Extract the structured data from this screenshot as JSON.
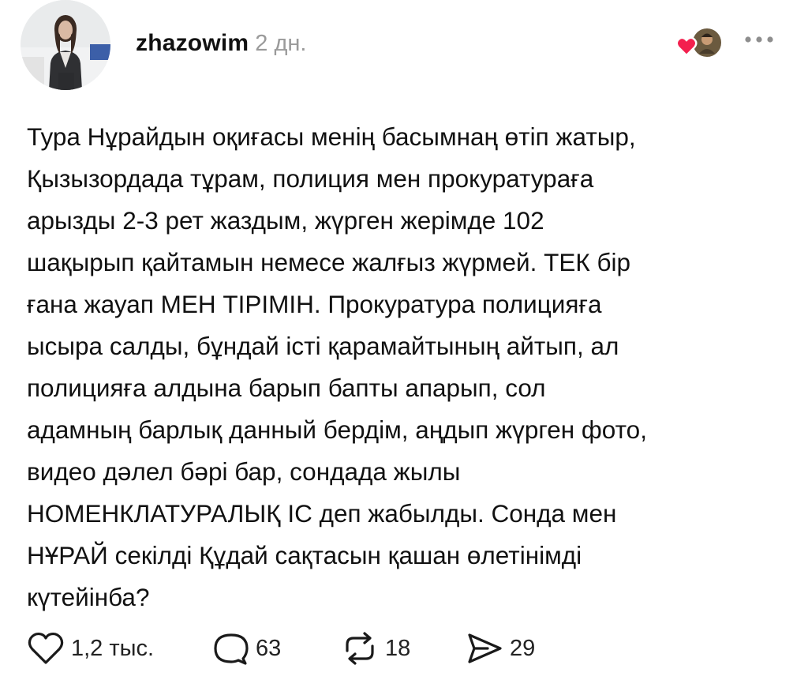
{
  "post": {
    "author": {
      "username": "zhazowim",
      "time": "2 дн."
    },
    "text": "Тура Нұрайдын оқиғасы менің басымнаң өтіп жатыр,\nҚызызордада тұрам, полиция мен прокуратураға\nарызды 2-3 рет жаздым, жүрген жерімде 102\nшақырып қайтамын немесе жалғыз жүрмей. ТЕК бір\nғана жауап МЕН ТІРІМІН. Прокуратура полицияға\nысыра салды, бұндай істі қарамайтының айтып, ал\nполицияға алдына барып бапты апарып, сол\nадамның барлық данный бердім, аңдып жүрген фото,\nвидео дәлел бәрі бар, сондада жылы\nНОМЕНКЛАТУРАЛЫҚ ІС деп жабылды. Сонда мен\nНҰРАЙ секілді Құдай сақтасын қашан өлетінімді\nкүтейінба?",
    "stats": {
      "likes": "1,2 тыс.",
      "comments": "63",
      "reposts": "18",
      "shares": "29"
    }
  },
  "icons": {
    "like": "heart-outline-icon",
    "comment": "speech-bubble-icon",
    "repost": "repost-arrows-icon",
    "share": "send-arrow-icon",
    "more": "ellipsis-icon",
    "reaction": "heart-reaction-with-avatar"
  },
  "colors": {
    "heart": "#f3204e",
    "text": "#111111",
    "muted": "#9a9a9a"
  }
}
